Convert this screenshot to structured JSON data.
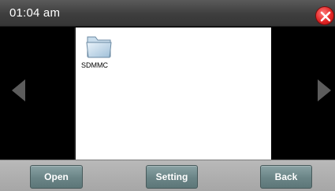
{
  "titlebar": {
    "time": "01:04 am"
  },
  "files": [
    {
      "label": "SDMMC",
      "icon": "folder-icon"
    }
  ],
  "buttons": {
    "open": "Open",
    "setting": "Setting",
    "back": "Back"
  },
  "colors": {
    "titlebar": "#3e3e3e",
    "close": "#e32626",
    "button": "#6a8486",
    "bottombar": "#a6a6a6",
    "arrow": "#5a5a5a"
  }
}
